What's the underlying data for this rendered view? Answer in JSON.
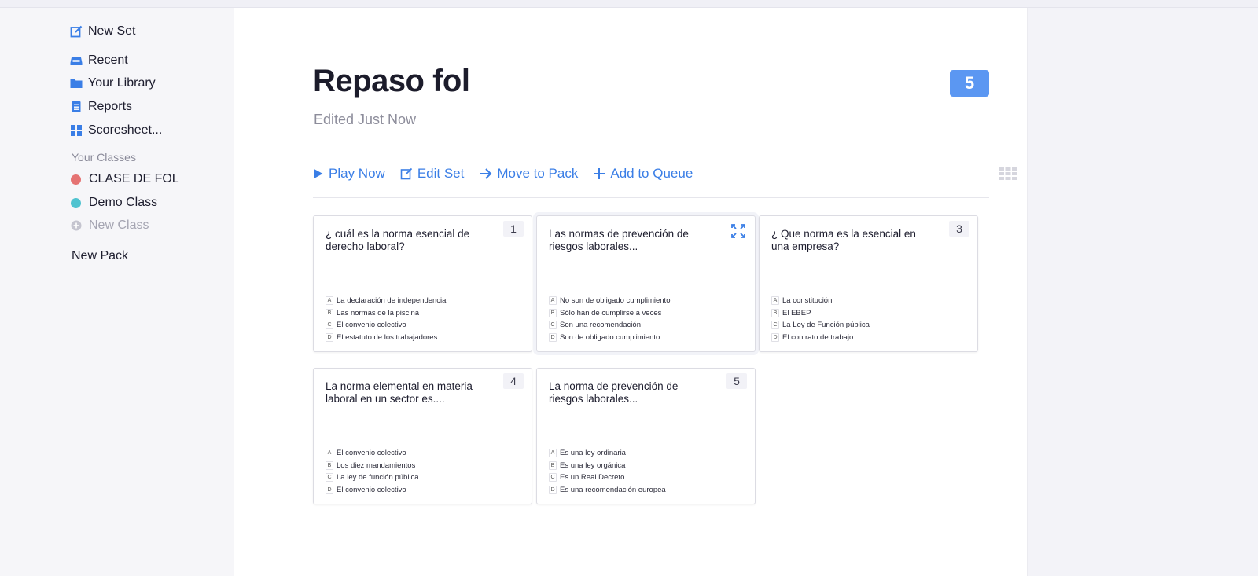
{
  "sidebar": {
    "new_set": "New Set",
    "recent": "Recent",
    "library": "Your Library",
    "reports": "Reports",
    "scoresheet": "Scoresheet...",
    "classes_label": "Your Classes",
    "classes": [
      {
        "label": "CLASE DE FOL",
        "color": "#e57373"
      },
      {
        "label": "Demo Class",
        "color": "#4fc3d0"
      }
    ],
    "new_class": "New Class",
    "new_pack": "New Pack"
  },
  "set": {
    "title": "Repaso fol",
    "subtitle": "Edited Just Now",
    "count": "5"
  },
  "actions": {
    "play": "Play Now",
    "edit": "Edit Set",
    "move": "Move to Pack",
    "queue": "Add to Queue"
  },
  "colors": {
    "accent": "#3a7ee6",
    "badge": "#5b97f2"
  },
  "questions": [
    {
      "number": "1",
      "text": "¿ cuál es la norma esencial de derecho laboral?",
      "answers": [
        "La declaración de independencia",
        "Las normas de la piscina",
        "El convenio colectivo",
        "El estatuto de los trabajadores"
      ]
    },
    {
      "number": "",
      "text": "Las normas de prevención de riesgos laborales...",
      "answers": [
        "No son de obligado cumplimiento",
        "Sólo han de cumplirse a veces",
        "Son una recomendación",
        "Son de obligado cumplimiento"
      ]
    },
    {
      "number": "3",
      "text": "¿ Que norma es la esencial en una empresa?",
      "answers": [
        "La constitución",
        "El EBEP",
        "La Ley de Función pública",
        "El contrato de trabajo"
      ]
    },
    {
      "number": "4",
      "text": "La norma elemental en materia laboral en un sector es....",
      "answers": [
        "El convenio colectivo",
        "Los diez mandamientos",
        "La ley de función pública",
        "El convenio colectivo"
      ]
    },
    {
      "number": "5",
      "text": "La norma de prevención de riesgos laborales...",
      "answers": [
        "Es una ley ordinaria",
        "Es una ley orgánica",
        "Es un Real Decreto",
        "Es una recomendación europea"
      ]
    }
  ],
  "letters": [
    "A",
    "B",
    "C",
    "D"
  ]
}
